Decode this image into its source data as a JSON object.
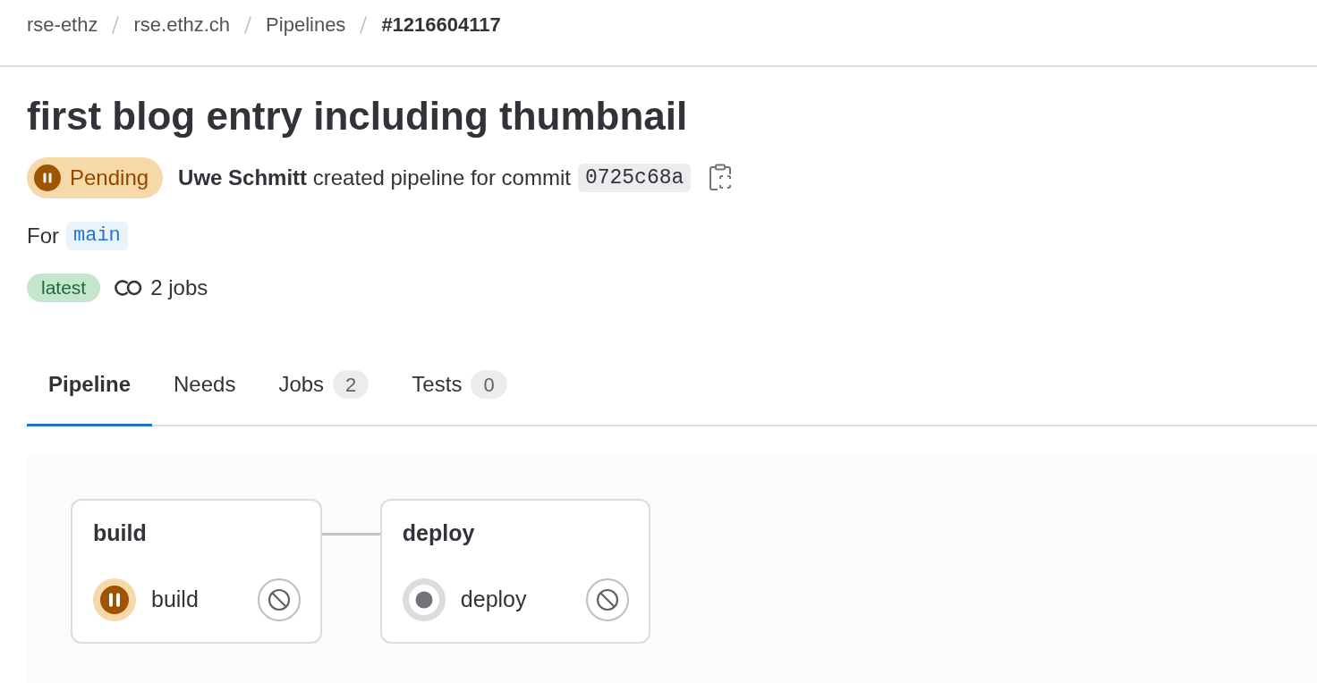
{
  "breadcrumbs": [
    {
      "label": "rse-ethz",
      "current": false
    },
    {
      "label": "rse.ethz.ch",
      "current": false
    },
    {
      "label": "Pipelines",
      "current": false
    },
    {
      "label": "#1216604117",
      "current": true
    }
  ],
  "title": "first blog entry including thumbnail",
  "status": {
    "label": "Pending",
    "kind": "pending"
  },
  "summary": "**Uwe Schmitt** created pipeline for commit",
  "commit": "0725c68a",
  "ref": {
    "prefix": "For",
    "name": "main"
  },
  "badges": [
    {
      "label": "latest"
    }
  ],
  "jobs_count": "2 jobs",
  "tabs": [
    {
      "label": "Pipeline",
      "selected": true
    },
    {
      "label": "Needs",
      "selected": false
    },
    {
      "label": "Jobs",
      "count": "2",
      "selected": false
    },
    {
      "label": "Tests",
      "count": "0",
      "selected": false
    }
  ],
  "stages": [
    {
      "name": "build",
      "jobs": [
        {
          "name": "build",
          "kind": "pending"
        }
      ]
    },
    {
      "name": "deploy",
      "jobs": [
        {
          "name": "deploy",
          "kind": "created"
        }
      ]
    }
  ]
}
